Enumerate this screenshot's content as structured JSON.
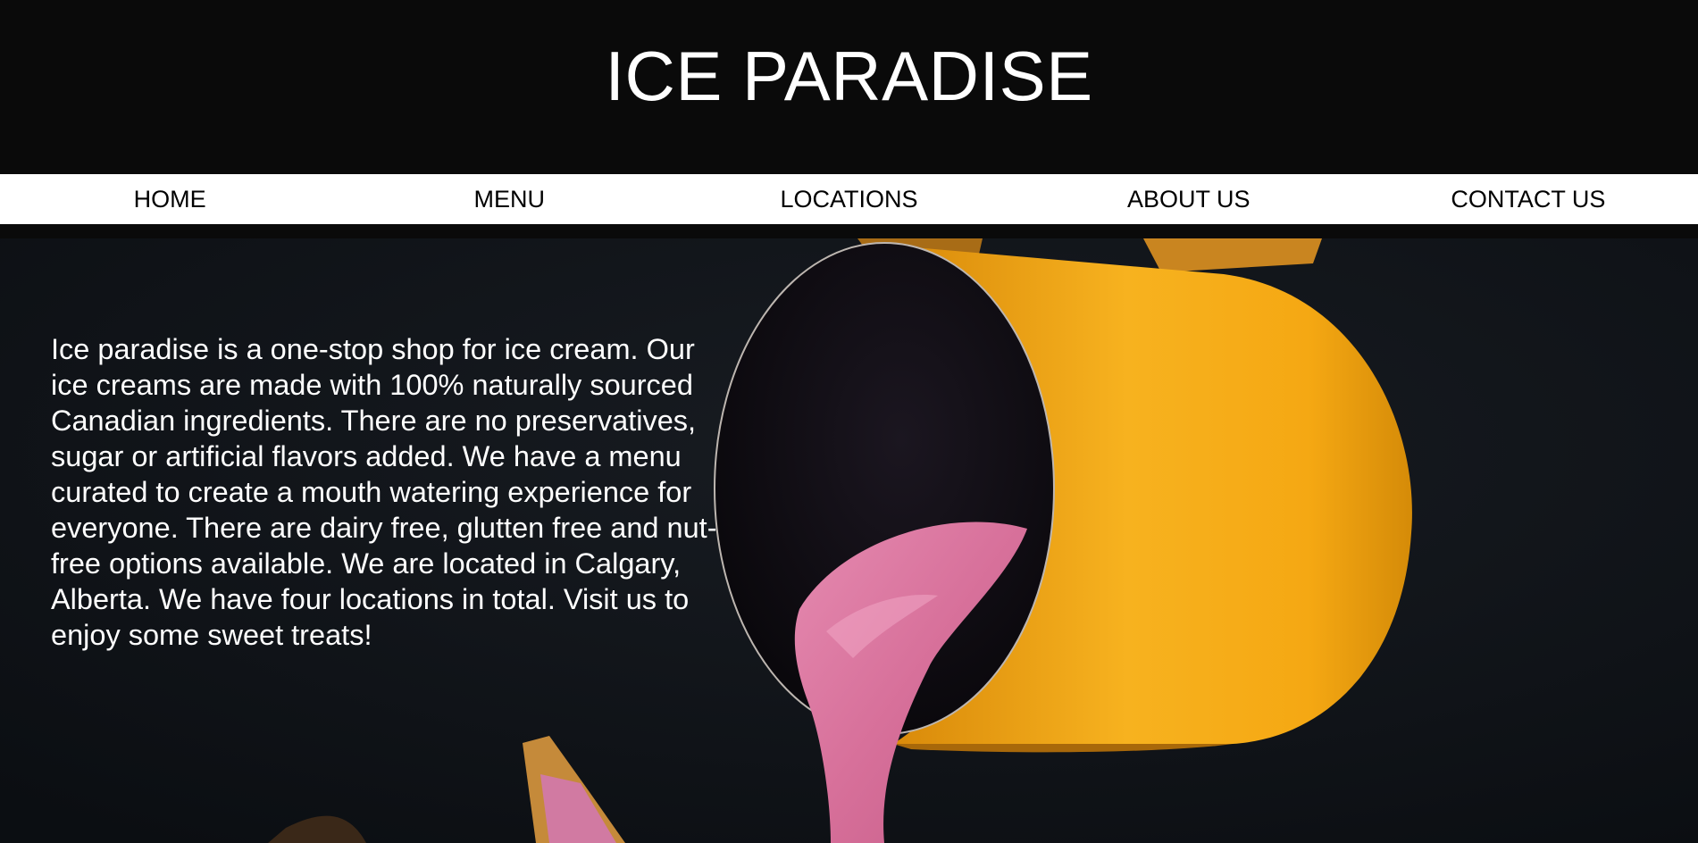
{
  "site": {
    "title": "ICE PARADISE"
  },
  "nav": {
    "items": [
      {
        "label": "HOME"
      },
      {
        "label": "MENU"
      },
      {
        "label": "LOCATIONS"
      },
      {
        "label": "ABOUT US"
      },
      {
        "label": "CONTACT US"
      }
    ]
  },
  "hero": {
    "description": "Ice paradise is a one-stop shop for ice cream. Our ice creams are made with 100% naturally sourced Canadian ingredients. There are no preservatives, sugar or artificial flavors added. We have a menu curated to create a mouth watering experience for everyone. There are dairy free, glutten free and nut-free options available. We are located in Calgary, Alberta. We have four locations in total. Visit us to enjoy some sweet treats!",
    "image_subject": "yellow-pitcher-pouring-pink-ice-cream"
  },
  "colors": {
    "header_bg": "#0a0a0a",
    "nav_bg": "#ffffff",
    "text_light": "#ffffff",
    "text_dark": "#000000",
    "pitcher": "#f5a716",
    "pour": "#d9739a"
  }
}
